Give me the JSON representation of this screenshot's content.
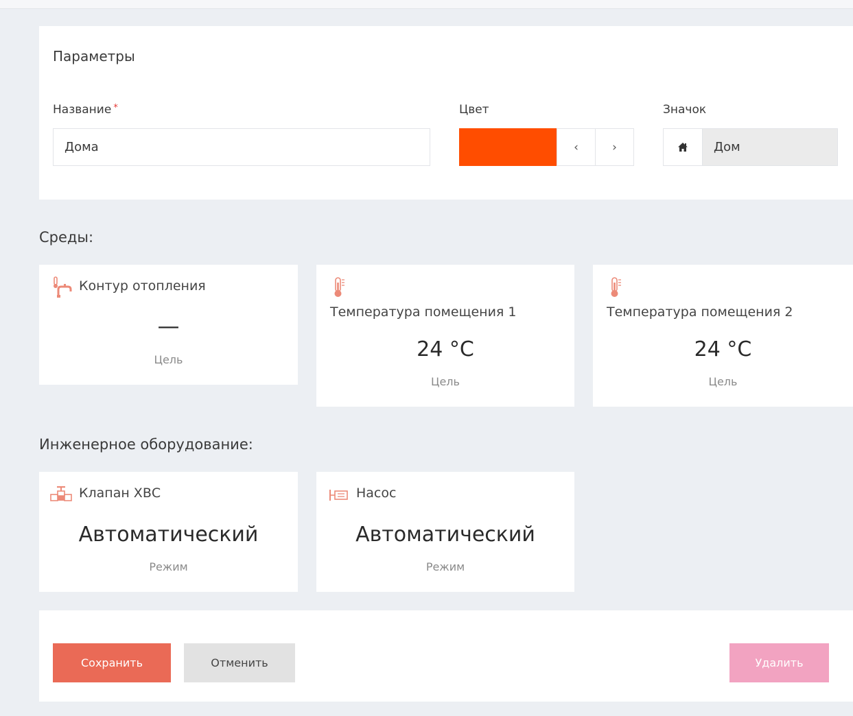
{
  "params": {
    "title": "Параметры",
    "name_label": "Название",
    "required_mark": "*",
    "name_value": "Дома",
    "color_label": "Цвет",
    "color_value": "#ff4d00",
    "prev_label": "‹",
    "next_label": "›",
    "icon_label": "Значок",
    "icon_name": "home-icon",
    "icon_value": "Дом"
  },
  "environments": {
    "title": "Среды:",
    "cards": [
      {
        "title": "Контур отопления",
        "value": "—",
        "caption": "Цель",
        "icon": "heating-tap-icon"
      },
      {
        "title": "Температура помещения 1",
        "value": "24 °C",
        "caption": "Цель",
        "icon": "thermometer-icon"
      },
      {
        "title": "Температура помещения 2",
        "value": "24 °C",
        "caption": "Цель",
        "icon": "thermometer-icon"
      }
    ]
  },
  "equipment": {
    "title": "Инженерное оборудование:",
    "cards": [
      {
        "title": "Клапан ХВС",
        "value": "Автоматический",
        "caption": "Режим",
        "icon": "valve-icon"
      },
      {
        "title": "Насос",
        "value": "Автоматический",
        "caption": "Режим",
        "icon": "pump-icon"
      }
    ]
  },
  "actions": {
    "save": "Сохранить",
    "cancel": "Отменить",
    "delete": "Удалить"
  },
  "colors": {
    "accent": "#ea6a56",
    "icon": "#ec8a78",
    "delete": "#f2a3c1",
    "background": "#eceff3"
  }
}
